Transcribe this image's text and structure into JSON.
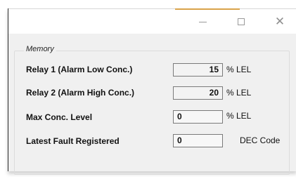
{
  "window": {
    "controls": {
      "minimize_icon": "minimize-icon",
      "maximize_icon": "maximize-icon",
      "close_glyph": "✕"
    }
  },
  "memory": {
    "group_title": "Memory",
    "rows": [
      {
        "label": "Relay 1 (Alarm Low Conc.)",
        "value": "15",
        "unit": "% LEL"
      },
      {
        "label": "Relay 2 (Alarm High Conc.)",
        "value": "20",
        "unit": "% LEL"
      },
      {
        "label": "Max Conc. Level",
        "value": "0",
        "unit": "% LEL"
      },
      {
        "label": "Latest Fault Registered",
        "value": "0",
        "unit": "DEC Code"
      }
    ]
  },
  "colors": {
    "window_bg": "#f0f0f0",
    "titlebar_bg": "#ffffff",
    "accent": "#d9a34a"
  }
}
